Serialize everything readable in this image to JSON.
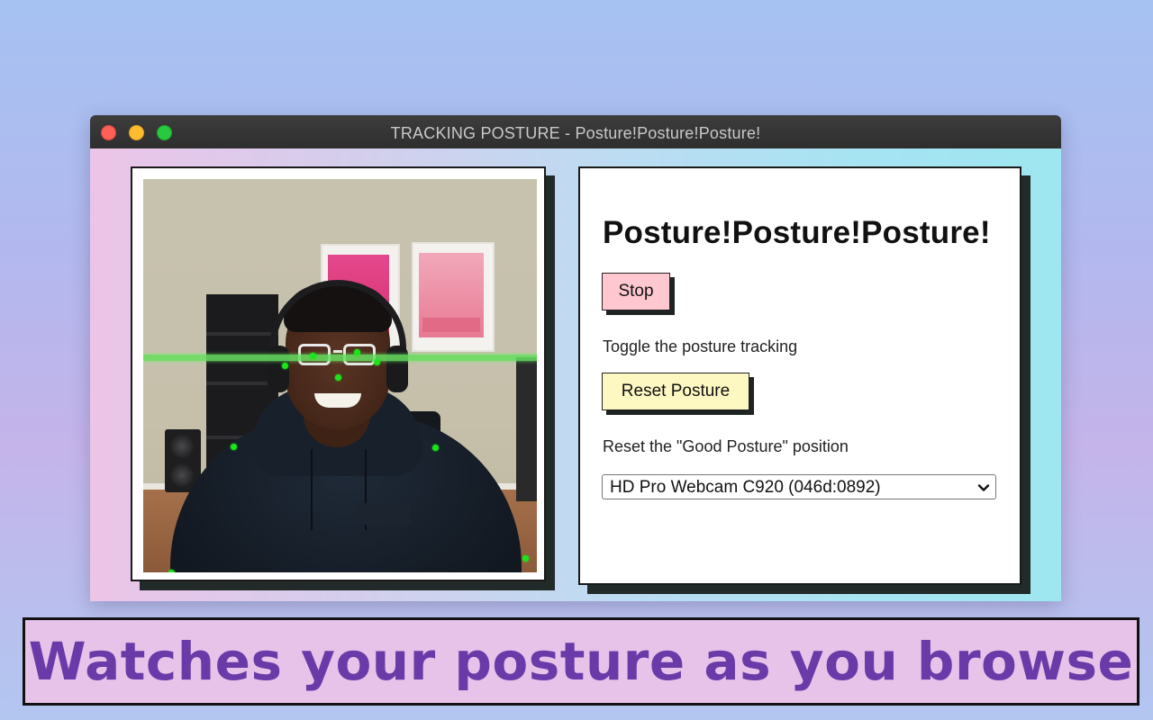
{
  "window": {
    "title": "TRACKING POSTURE - Posture!Posture!Posture!",
    "controls": [
      "close",
      "minimize",
      "maximize"
    ]
  },
  "video": {
    "icon": "webcam-feed",
    "keypoint_color": "#1fe21f",
    "posture_line_color": "#66e060"
  },
  "panel": {
    "title": "Posture!Posture!Posture!",
    "stop_button": {
      "label": "Stop",
      "color": "#ffc8d0"
    },
    "toggle_description": "Toggle the posture tracking",
    "reset_button": {
      "label": "Reset Posture",
      "color": "#fdf8c2"
    },
    "reset_description": "Reset the \"Good Posture\" position",
    "camera_select": {
      "selected": "HD Pro Webcam C920 (046d:0892)"
    }
  },
  "banner": {
    "text": "Watches your posture as you browse",
    "background": "#e7c3ea",
    "text_color": "#6a3aa8"
  }
}
